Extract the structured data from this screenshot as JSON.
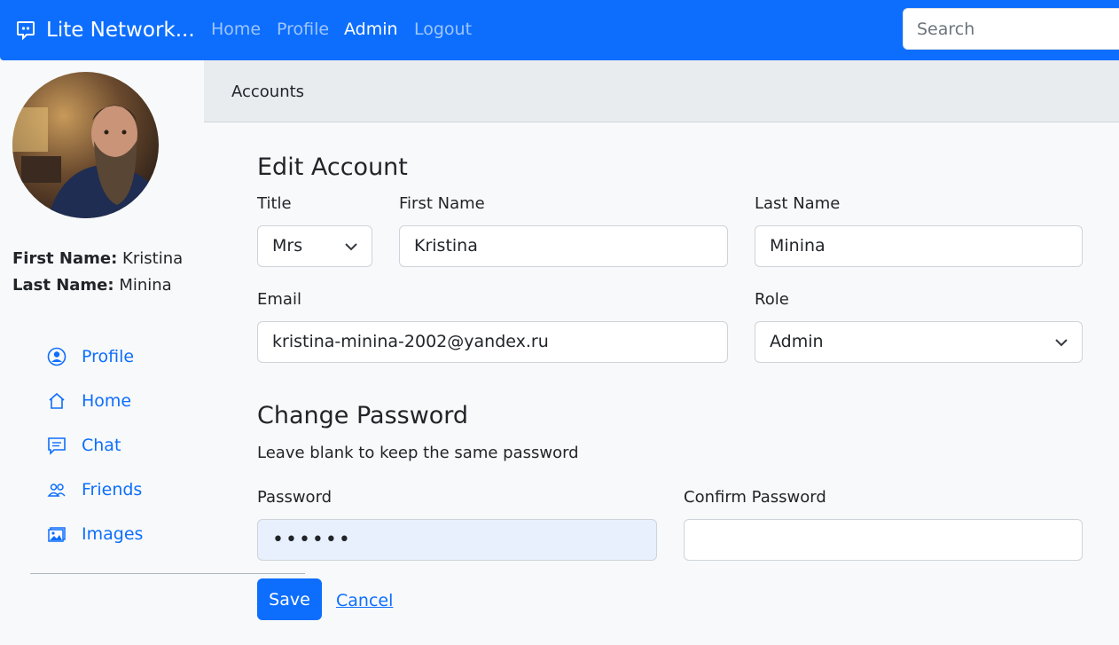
{
  "navbar": {
    "brand": "Lite Network...",
    "links": [
      "Home",
      "Profile",
      "Admin",
      "Logout"
    ],
    "active": "Admin",
    "search_placeholder": "Search"
  },
  "profile": {
    "first_name_label": "First Name:",
    "first_name": "Kristina",
    "last_name_label": "Last Name:",
    "last_name": "Minina"
  },
  "sidebar": {
    "items": [
      {
        "label": "Profile",
        "icon": "person-circle-icon"
      },
      {
        "label": "Home",
        "icon": "house-icon"
      },
      {
        "label": "Chat",
        "icon": "chat-icon"
      },
      {
        "label": "Friends",
        "icon": "people-icon"
      },
      {
        "label": "Images",
        "icon": "images-icon"
      }
    ]
  },
  "breadcrumb": "Accounts",
  "form": {
    "heading": "Edit Account",
    "title_label": "Title",
    "title_value": "Mrs",
    "first_name_label": "First Name",
    "first_name_value": "Kristina",
    "last_name_label": "Last Name",
    "last_name_value": "Minina",
    "email_label": "Email",
    "email_value": "kristina-minina-2002@yandex.ru",
    "role_label": "Role",
    "role_value": "Admin",
    "password_heading": "Change Password",
    "password_hint": "Leave blank to keep the same password",
    "password_label": "Password",
    "password_value": "••••••",
    "confirm_label": "Confirm Password",
    "confirm_value": "",
    "save_label": "Save",
    "cancel_label": "Cancel"
  },
  "colors": {
    "primary": "#0d6efd",
    "background": "#f8f9fa",
    "autofill": "#e8f0fe"
  }
}
